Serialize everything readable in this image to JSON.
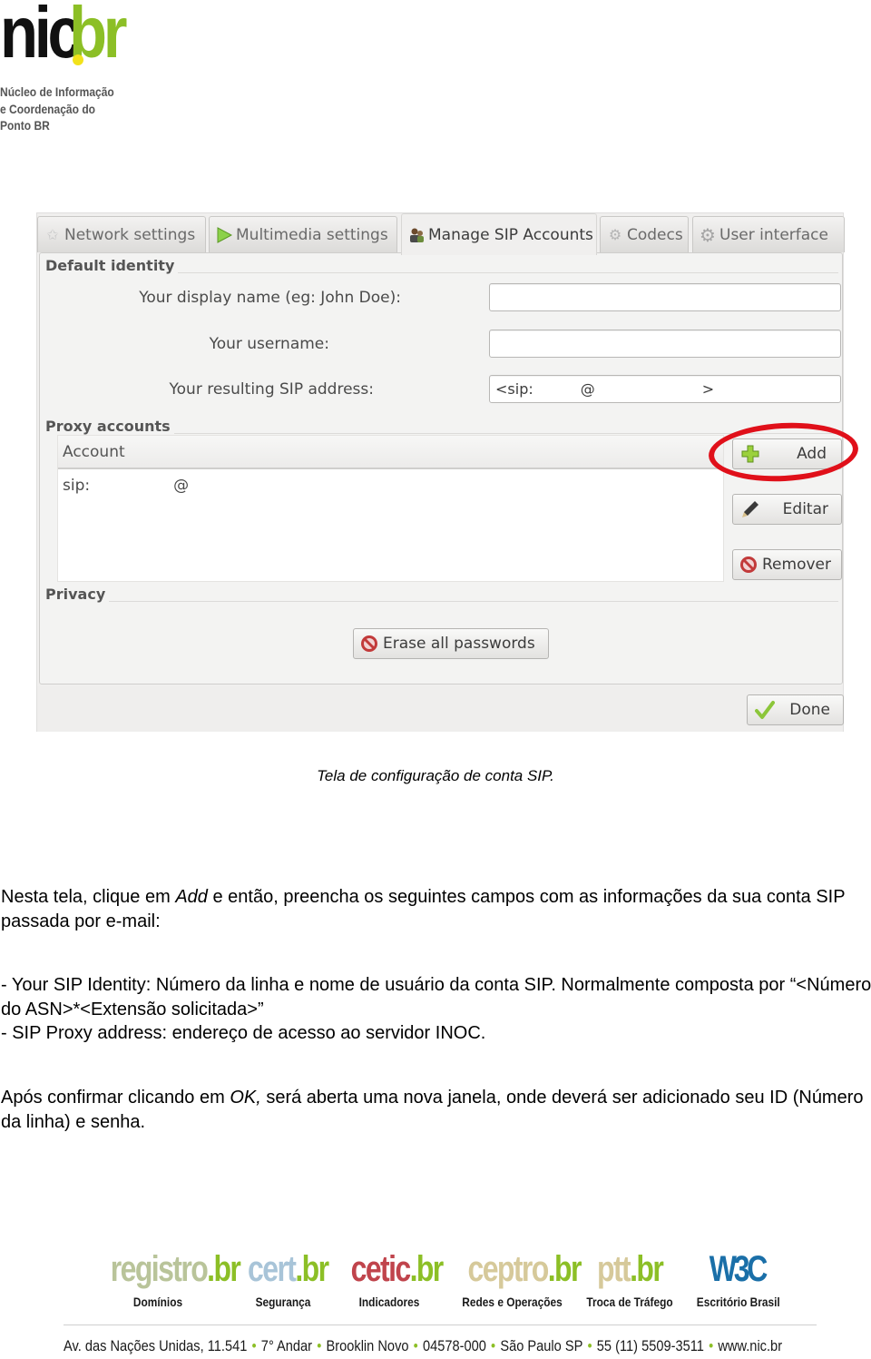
{
  "logo": {
    "mark_main": "nic",
    "mark_dot": ".",
    "mark_suffix": "br",
    "subtitle_lines": [
      "Núcleo de Informação",
      "e Coordenação do",
      "Ponto BR"
    ],
    "colors": {
      "main": "#111111",
      "suffix": "#8cbf26",
      "dot": "#f2e21b"
    }
  },
  "window": {
    "tabs": [
      {
        "label": "Network settings",
        "icon": "star-icon",
        "active": false
      },
      {
        "label": "Multimedia settings",
        "icon": "play-icon",
        "active": false
      },
      {
        "label": "Manage SIP Accounts",
        "icon": "users-icon",
        "active": true
      },
      {
        "label": "Codecs",
        "icon": "gears-icon",
        "active": false
      },
      {
        "label": "User interface",
        "icon": "gear-icon",
        "active": false
      }
    ],
    "default_identity": {
      "title": "Default identity",
      "display_name_label": "Your display name (eg: John Doe):",
      "display_name_value": "",
      "username_label": "Your username:",
      "username_value": "",
      "sip_address_label": "Your resulting SIP address:",
      "sip_address_prefix": "<sip:",
      "sip_address_at": "@",
      "sip_address_suffix": ">"
    },
    "proxy_accounts": {
      "title": "Proxy accounts",
      "column_header": "Account",
      "rows": [
        {
          "prefix": "sip:",
          "at": "@"
        }
      ],
      "buttons": {
        "add": "Add",
        "edit": "Editar",
        "remove": "Remover"
      },
      "highlight_color": "#e0101a"
    },
    "privacy": {
      "title": "Privacy",
      "erase_button": "Erase all passwords"
    },
    "done_button": "Done"
  },
  "caption": "Tela de configuração de conta SIP.",
  "body": {
    "p1_before": "Nesta tela, clique em ",
    "p1_em": "Add",
    "p1_after": " e então, preencha os seguintes campos com as informações da sua conta SIP passada por e-mail:",
    "p2_line1": "- Your SIP Identity: Número da linha e nome de usuário da conta SIP. Normalmente composta por “<Número do ASN>*<Extensão solicitada>”",
    "p2_line2": "- SIP Proxy address: endereço de acesso ao servidor INOC.",
    "p3_before": "Após confirmar clicando em ",
    "p3_em": "OK,",
    "p3_after": " será aberta uma nova janela, onde deverá ser adicionado seu ID (Número da linha) e senha."
  },
  "footer": {
    "partners": [
      {
        "name": "registro",
        "suffix": ".br",
        "caption": "Domínios",
        "color": "#b9c49a"
      },
      {
        "name": "cert",
        "suffix": ".br",
        "caption": "Segurança",
        "color": "#a8c4d8"
      },
      {
        "name": "cetic",
        "suffix": ".br",
        "caption": "Indicadores",
        "color": "#c0444c"
      },
      {
        "name": "ceptro",
        "suffix": ".br",
        "caption": "Redes e Operações",
        "color": "#d6c99a"
      },
      {
        "name": "ptt",
        "suffix": ".br",
        "caption": "Troca de Tráfego",
        "color": "#d6c99a"
      },
      {
        "name": "W3C",
        "suffix": "",
        "caption": "Escritório Brasil",
        "color": "#1a6fa8"
      }
    ],
    "address_parts": [
      "Av. das Nações Unidas, 11.541",
      "7° Andar",
      "Brooklin Novo",
      "04578-000",
      "São Paulo SP",
      "55 (11) 5509-3511",
      "www.nic.br"
    ],
    "separator": "•"
  }
}
